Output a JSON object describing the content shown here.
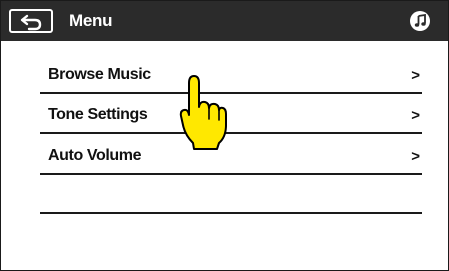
{
  "header": {
    "title": "Menu",
    "back_icon": "back-arrow-icon",
    "music_icon": "music-note-icon"
  },
  "menu": {
    "items": [
      {
        "label": "Browse Music",
        "chevron": ">"
      },
      {
        "label": "Tone Settings",
        "chevron": ">"
      },
      {
        "label": "Auto Volume",
        "chevron": ">"
      }
    ]
  },
  "overlay": {
    "pointer_icon": "pointing-hand-icon",
    "pointer_color": "#ffe800"
  },
  "colors": {
    "header_bg": "#2b2b2b",
    "text": "#111111"
  }
}
